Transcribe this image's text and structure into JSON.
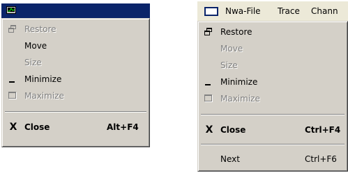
{
  "left_window": {
    "menu": [
      {
        "label": "Restore",
        "icon": "restore-icon",
        "enabled": false
      },
      {
        "label": "Move",
        "enabled": true
      },
      {
        "label": "Size",
        "enabled": false
      },
      {
        "label": "Minimize",
        "icon": "minimize-icon",
        "enabled": true
      },
      {
        "label": "Maximize",
        "icon": "maximize-icon",
        "enabled": false
      },
      {
        "label": "Close",
        "icon": "close-icon",
        "accelerator": "Alt+F4",
        "enabled": true,
        "bold": true
      }
    ],
    "close_glyph": "X"
  },
  "right_window": {
    "menubar": [
      "Nwa-File",
      "Trace",
      "Chann"
    ],
    "menu": [
      {
        "label": "Restore",
        "icon": "restore-icon",
        "enabled": true
      },
      {
        "label": "Move",
        "enabled": false
      },
      {
        "label": "Size",
        "enabled": false
      },
      {
        "label": "Minimize",
        "icon": "minimize-icon",
        "enabled": true
      },
      {
        "label": "Maximize",
        "icon": "maximize-icon",
        "enabled": false
      },
      {
        "label": "Close",
        "icon": "close-icon",
        "accelerator": "Ctrl+F4",
        "enabled": true,
        "bold": true
      },
      {
        "label": "Next",
        "accelerator": "Ctrl+F6",
        "enabled": true
      }
    ],
    "close_glyph": "X"
  },
  "colors": {
    "menu_face": "#d4d0c8",
    "disabled_text": "#808080",
    "active_title": "#0a246a"
  }
}
